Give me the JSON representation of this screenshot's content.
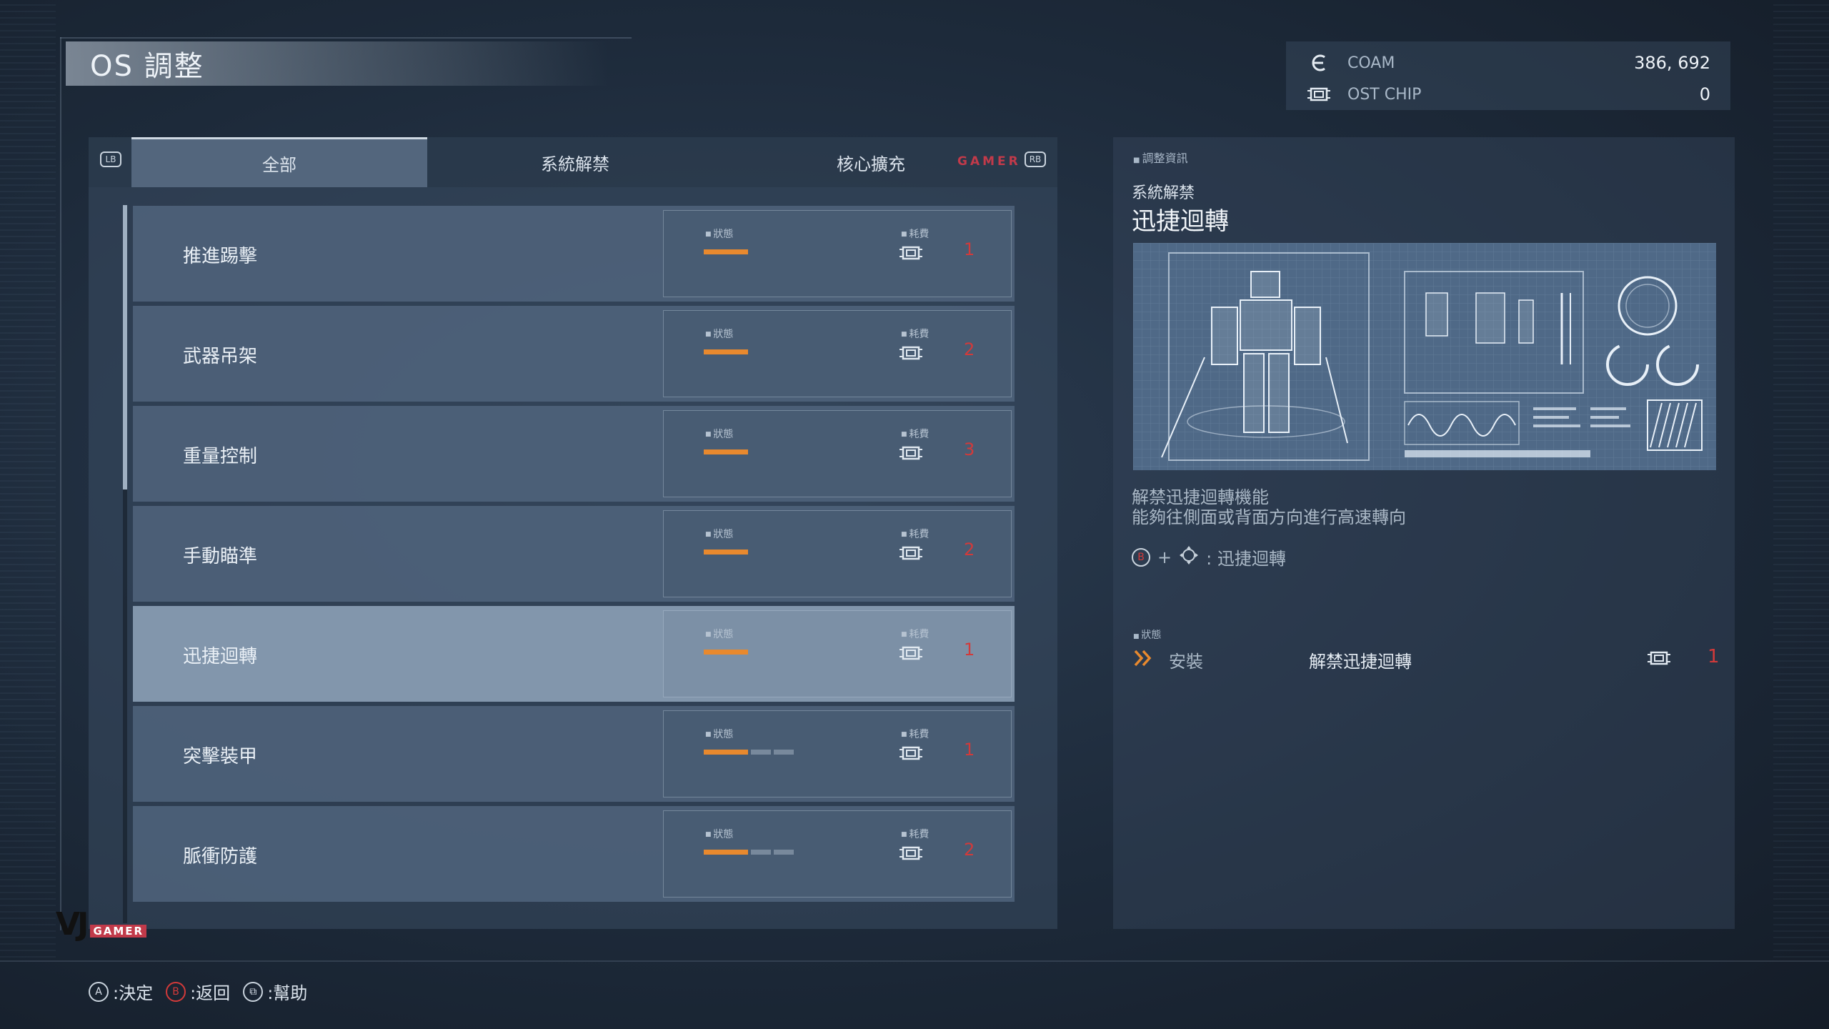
{
  "title": "OS 調整",
  "currency": {
    "coam_label": "COAM",
    "coam_value": "386, 692",
    "chip_label": "OST CHIP",
    "chip_value": "0"
  },
  "tabs": {
    "lb": "LB",
    "rb": "RB",
    "items": [
      {
        "label": "全部",
        "active": true
      },
      {
        "label": "系統解禁",
        "active": false
      },
      {
        "label": "核心擴充",
        "active": false
      }
    ],
    "watermark": "GAMER"
  },
  "labels": {
    "status": "狀態",
    "cost": "耗費"
  },
  "rows": [
    {
      "name": "推進踢擊",
      "level": 1,
      "max_level": 1,
      "cost": "1"
    },
    {
      "name": "武器吊架",
      "level": 1,
      "max_level": 1,
      "cost": "2"
    },
    {
      "name": "重量控制",
      "level": 1,
      "max_level": 1,
      "cost": "3"
    },
    {
      "name": "手動瞄準",
      "level": 1,
      "max_level": 1,
      "cost": "2"
    },
    {
      "name": "迅捷迴轉",
      "level": 1,
      "max_level": 1,
      "cost": "1",
      "selected": true
    },
    {
      "name": "突擊裝甲",
      "level": 1,
      "max_level": 3,
      "cost": "1"
    },
    {
      "name": "脈衝防護",
      "level": 1,
      "max_level": 3,
      "cost": "2"
    }
  ],
  "detail": {
    "header": "調整資訊",
    "category": "系統解禁",
    "title": "迅捷迴轉",
    "desc1": "解禁迅捷迴轉機能",
    "desc2": "能夠往側面或背面方向進行高速轉向",
    "control_button": "B",
    "control_plus": "+",
    "control_text": ": 迅捷迴轉",
    "status_header": "狀態",
    "install": "安裝",
    "effect": "解禁迅捷迴轉",
    "cost": "1"
  },
  "hints": [
    {
      "button": "A",
      "label": ":決定"
    },
    {
      "button": "B",
      "label": ":返回"
    },
    {
      "button": "⧉",
      "label": ":幫助"
    }
  ],
  "logo": {
    "big": "VJ",
    "small": "GAMER"
  },
  "colors": {
    "accent_orange": "#e8892e",
    "cost_red": "#d23a3a",
    "watermark_red": "#c23a4a"
  }
}
